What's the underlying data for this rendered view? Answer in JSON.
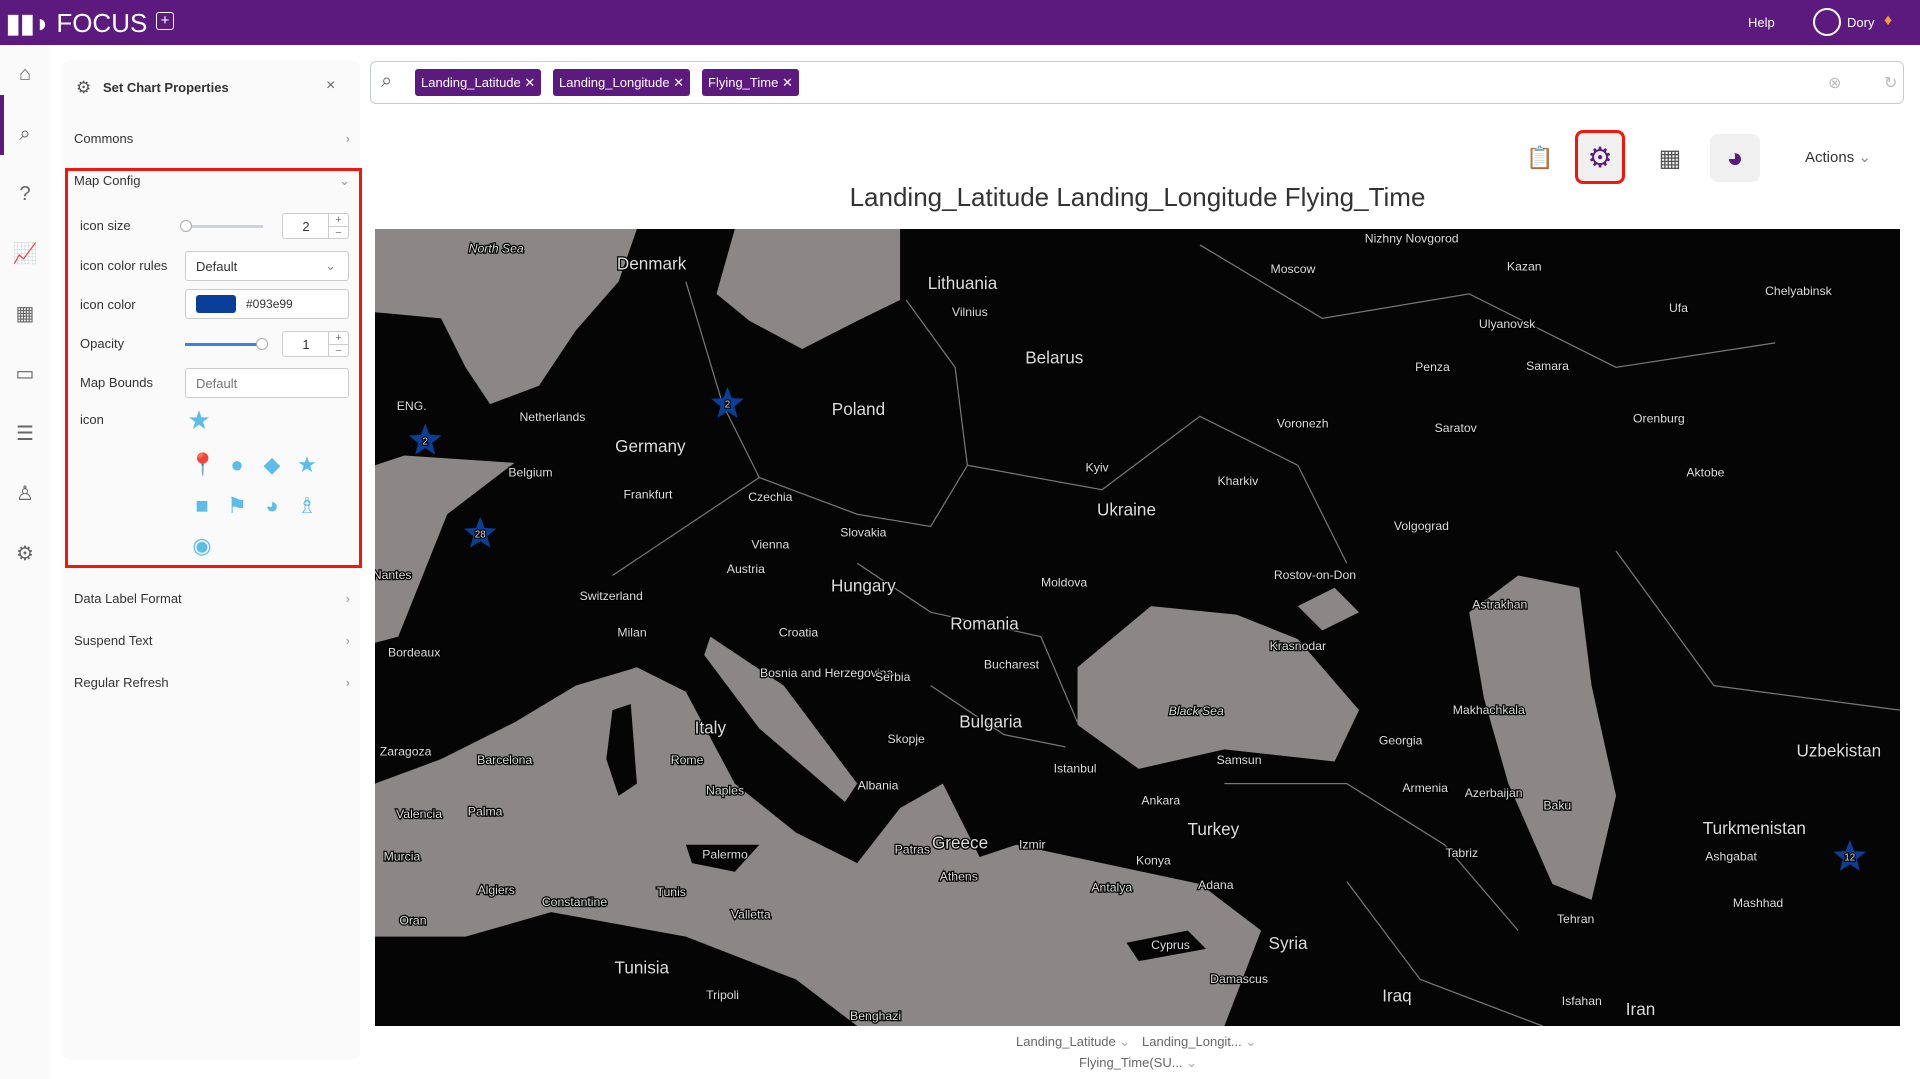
{
  "app": {
    "name": "FOCUS",
    "help": "Help",
    "user": "Dory"
  },
  "panel": {
    "title": "Set Chart Properties",
    "commons": "Commons",
    "map_config": "Map Config",
    "icon_size_label": "icon size",
    "icon_size": "2",
    "icon_color_rules_label": "icon color rules",
    "icon_color_rules": "Default",
    "icon_color_label": "icon color",
    "icon_color": "#093e99",
    "opacity_label": "Opacity",
    "opacity": "1",
    "map_bounds_label": "Map Bounds",
    "map_bounds_placeholder": "Default",
    "icon_label": "icon",
    "selected_icon": "star",
    "icon_options": [
      "map-pin",
      "circle",
      "diamond",
      "star",
      "square",
      "flag",
      "satellite-dish",
      "tower",
      "badge"
    ],
    "data_label_format": "Data Label Format",
    "suspend_text": "Suspend Text",
    "regular_refresh": "Regular Refresh"
  },
  "search": {
    "chips": [
      "Landing_Latitude",
      "Landing_Longitude",
      "Flying_Time"
    ]
  },
  "toolbar": {
    "actions": "Actions"
  },
  "chart": {
    "title": "Landing_Latitude Landing_Longitude Flying_Time",
    "markers": [
      {
        "label": "2"
      },
      {
        "label": "2"
      },
      {
        "label": "28"
      },
      {
        "label": "12"
      }
    ],
    "map_labels": [
      "North Sea",
      "Denmark",
      "Lithuania",
      "Vilnius",
      "Belarus",
      "Poland",
      "Netherlands",
      "Germany",
      "Belgium",
      "Frankfurt",
      "Czechia",
      "Slovakia",
      "Vienna",
      "Austria",
      "Hungary",
      "Switzerland",
      "Milan",
      "Croatia",
      "Romania",
      "Bucharest",
      "Bosnia and Herzegovina",
      "Serbia",
      "Bulgaria",
      "Italy",
      "Rome",
      "Naples",
      "Albania",
      "Skopje",
      "Greece",
      "Athens",
      "Izmir",
      "Istanbul",
      "Ankara",
      "Turkey",
      "Konya",
      "Antalya",
      "Adana",
      "Cyprus",
      "Syria",
      "Damascus",
      "Iraq",
      "Samsun",
      "Black Sea",
      "Georgia",
      "Armenia",
      "Azerbaijan",
      "Baku",
      "Tabriz",
      "Tehran",
      "Iran",
      "Isfahan",
      "Turkmenistan",
      "Ashgabat",
      "Mashhad",
      "Uzbekistan",
      "Ukraine",
      "Kyiv",
      "Moldova",
      "Kharkiv",
      "Rostov-on-Don",
      "Volgograd",
      "Krasnodar",
      "Astrakhan",
      "Makhachkala",
      "Voronezh",
      "Saratov",
      "Samara",
      "Penza",
      "Ulyanovsk",
      "Kazan",
      "Moscow",
      "Nizhny Novgorod",
      "Ufa",
      "Chelyabinsk",
      "Orenburg",
      "Aktobe",
      "Barcelona",
      "Zaragoza",
      "Valencia",
      "Palma",
      "Murcia",
      "Algiers",
      "Constantine",
      "Tunis",
      "Tunisia",
      "Tripoli",
      "Valletta",
      "Palermo",
      "Benghazi",
      "Oran",
      "Nantes",
      "Bordeaux",
      "ENG.",
      "Patras"
    ],
    "legend": [
      "Landing_Latitude",
      "Landing_Longit...",
      "Flying_Time(SU..."
    ],
    "colors": {
      "land": "#050505",
      "sea": "#8c8787",
      "marker": "#093e99"
    }
  }
}
